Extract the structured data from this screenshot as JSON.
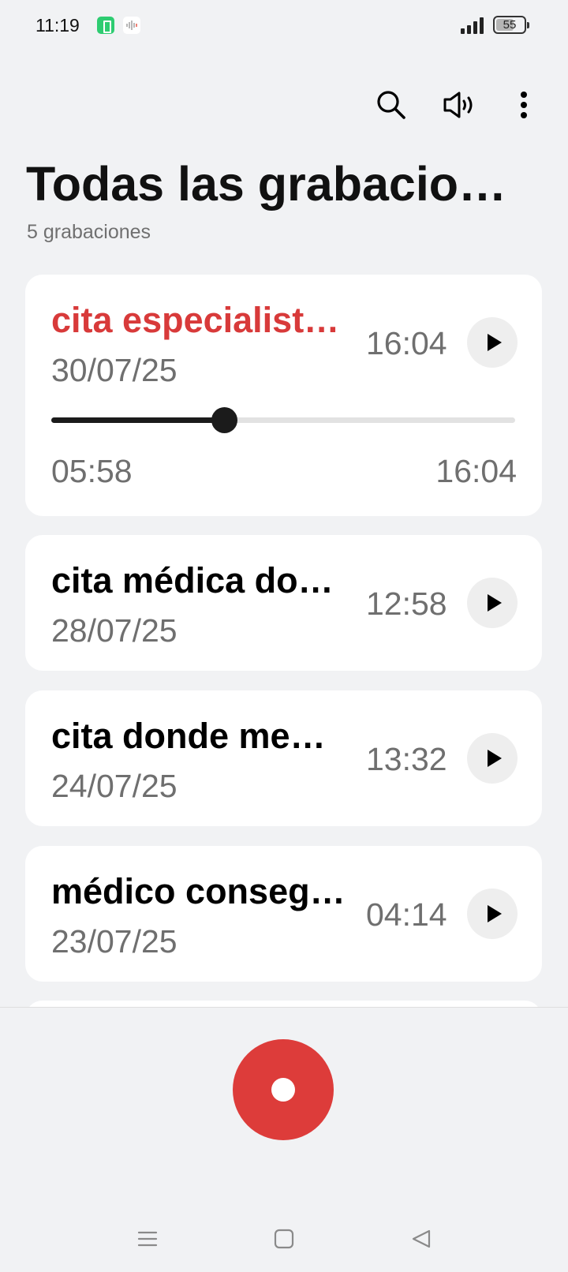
{
  "status_bar": {
    "time": "11:19",
    "battery_level": "55",
    "icons": [
      "battery-saver-icon",
      "sound-recorder-icon",
      "signal-icon",
      "battery-icon"
    ]
  },
  "toolbar": {
    "icons": [
      "search-icon",
      "speaker-icon",
      "more-options-icon"
    ]
  },
  "header": {
    "title": "Todas las grabacio…",
    "subtitle": "5 grabaciones"
  },
  "recordings": [
    {
      "title": "cita especialist…",
      "date": "30/07/25",
      "duration": "16:04",
      "playing": true,
      "elapsed": "05:58",
      "total": "16:04",
      "progress": 0.373
    },
    {
      "title": "cita médica do…",
      "date": "28/07/25",
      "duration": "12:58",
      "playing": false
    },
    {
      "title": "cita donde me…",
      "date": "24/07/25",
      "duration": "13:32",
      "playing": false
    },
    {
      "title": "médico conseg…",
      "date": "23/07/25",
      "duration": "04:14",
      "playing": false
    }
  ],
  "colors": {
    "accent": "#dd3c3a",
    "background": "#f1f2f4",
    "card": "#ffffff",
    "secondary_text": "#6f6f6f"
  },
  "bottom": {
    "record_icon": "record-icon",
    "nav_icons": [
      "menu-icon",
      "home-icon",
      "back-icon"
    ]
  }
}
